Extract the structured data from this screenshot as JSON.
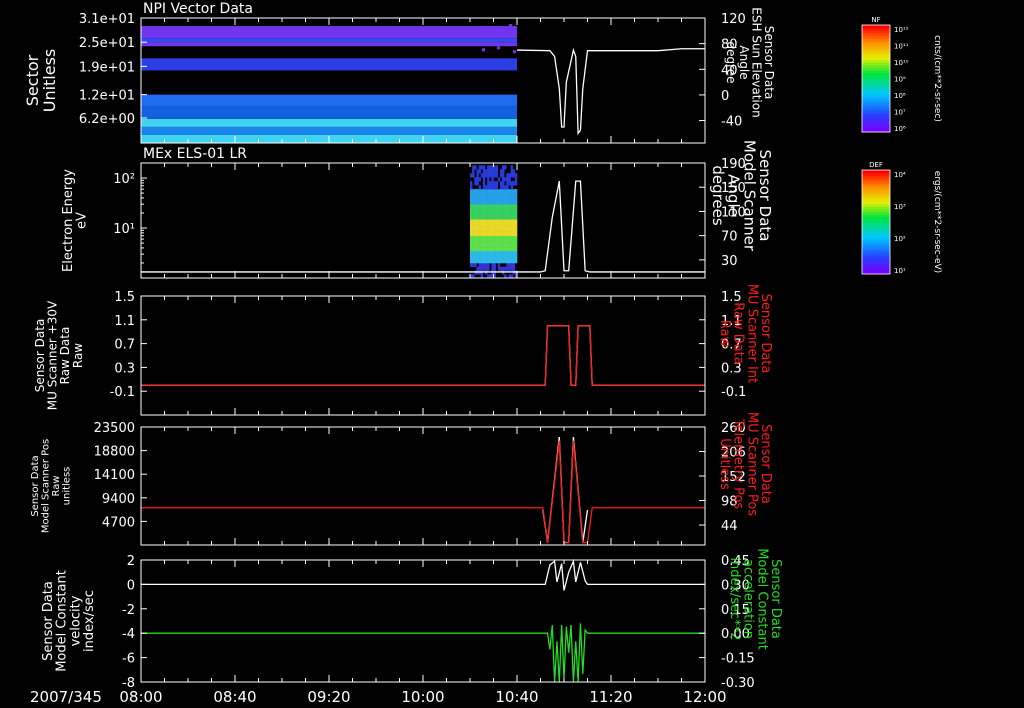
{
  "date_label": "2007/345",
  "time_ticks": [
    "08:00",
    "08:40",
    "09:20",
    "10:00",
    "10:40",
    "11:20",
    "12:00"
  ],
  "colors": {
    "white": "#ffffff",
    "red": "#ff1a1a",
    "green": "#22dd22",
    "frame": "#ffffff"
  },
  "chart_data": [
    {
      "type": "heatmap",
      "title": "NPI Vector Data",
      "ylabel": [
        "Sector",
        "Unitless"
      ],
      "yticks": [
        "3.1e+01",
        "2.5e+01",
        "1.9e+01",
        "1.2e+01",
        "6.2e+00"
      ],
      "ytick_values": [
        31,
        25,
        19,
        12,
        6.2
      ],
      "ylim": [
        0,
        31
      ],
      "x_data_range": [
        "08:00",
        "10:40"
      ],
      "bands": [
        {
          "y0": 0,
          "y1": 2,
          "color": "#3fd3f0"
        },
        {
          "y0": 2,
          "y1": 4,
          "color": "#1a84ea"
        },
        {
          "y0": 4,
          "y1": 6,
          "color": "#3fd3f0"
        },
        {
          "y0": 6,
          "y1": 9,
          "color": "#1260e0"
        },
        {
          "y0": 9,
          "y1": 12,
          "color": "#1e6af0"
        },
        {
          "y0": 18,
          "y1": 21,
          "color": "#2d3ee4"
        },
        {
          "y0": 24,
          "y1": 25,
          "color": "#7433ee"
        },
        {
          "y0": 25,
          "y1": 26,
          "color": "#2f4cf0"
        },
        {
          "y0": 26,
          "y1": 29,
          "color": "#7433ee"
        }
      ],
      "right_axis": {
        "label": [
          "Sensor Data",
          "ESH Sun Elevation",
          "Angle",
          "degree"
        ],
        "yticks": [
          "120",
          "80",
          "40",
          "0",
          "-40"
        ],
        "ytick_values": [
          120,
          80,
          40,
          0,
          -40
        ],
        "ylim": [
          -75,
          120
        ],
        "line_color": "#ffffff",
        "series": {
          "x": [
            "10:40",
            "10:54",
            "10:56",
            "10:58",
            "10:59",
            "11:00",
            "11:01",
            "11:04",
            "11:05",
            "11:06",
            "11:07",
            "11:08",
            "11:10",
            "11:40",
            "11:50",
            "12:00"
          ],
          "y": [
            70,
            69,
            60,
            10,
            -50,
            -50,
            20,
            70,
            60,
            -60,
            -55,
            10,
            69,
            69,
            72,
            72
          ]
        }
      },
      "colorbar": {
        "label": "NF",
        "units": "cnts/(cm**2-sr-sec)",
        "ticks": [
          "10¹²",
          "10¹¹",
          "10¹⁰",
          "10⁹",
          "10⁸",
          "10⁷",
          "10⁶"
        ]
      }
    },
    {
      "type": "heatmap",
      "title": "MEx ELS-01 LR",
      "ylabel": [
        "Electron Energy",
        "eV"
      ],
      "yticks": [
        "10²",
        "10¹"
      ],
      "ytick_values": [
        100,
        10
      ],
      "ylim_log": [
        1,
        200
      ],
      "x_data_range": [
        "10:20",
        "10:40"
      ],
      "energy_profile": [
        {
          "e0": 1,
          "e1": 2,
          "color": "#3333d0"
        },
        {
          "e0": 2,
          "e1": 3.5,
          "color": "#2cb8e8"
        },
        {
          "e0": 3.5,
          "e1": 7,
          "color": "#5ee04a"
        },
        {
          "e0": 7,
          "e1": 15,
          "color": "#e8d82a"
        },
        {
          "e0": 15,
          "e1": 30,
          "color": "#38d060"
        },
        {
          "e0": 30,
          "e1": 60,
          "color": "#26a0e6"
        },
        {
          "e0": 60,
          "e1": 180,
          "color": "#2a3ad8"
        }
      ],
      "right_axis": {
        "label": [
          "Sensor Data",
          "Model Scanner",
          "Angle",
          "degrees"
        ],
        "yticks": [
          "190",
          "150",
          "110",
          "70",
          "30"
        ],
        "ytick_values": [
          190,
          150,
          110,
          70,
          30
        ],
        "ylim": [
          0,
          190
        ],
        "line_color": "#ffffff",
        "series": {
          "x": [
            "08:00",
            "10:40",
            "10:50",
            "10:52",
            "10:55",
            "10:58",
            "11:00",
            "11:02",
            "11:05",
            "11:07",
            "11:09",
            "11:11",
            "11:14",
            "12:00"
          ],
          "y": [
            10,
            10,
            10,
            12,
            100,
            160,
            12,
            12,
            160,
            160,
            12,
            10,
            10,
            10
          ]
        }
      },
      "colorbar": {
        "label": "DEF",
        "units": "ergs/(cm**2-sr-sec-eV)",
        "ticks": [
          "10⁴",
          "10³",
          "10²",
          "10¹"
        ]
      }
    },
    {
      "type": "line",
      "ylabel": [
        "Sensor Data",
        "MU Scanner +30V",
        "Raw Data",
        "Raw"
      ],
      "yticks": [
        "1.5",
        "1.1",
        "0.7",
        "0.3",
        "-0.1"
      ],
      "ytick_values": [
        1.5,
        1.1,
        0.7,
        0.3,
        -0.1
      ],
      "ylim": [
        -0.5,
        1.5
      ],
      "right_axis": {
        "label": [
          "Sensor Data",
          "MU Scanner Int",
          "Raw Data",
          "Raw"
        ],
        "yticks": [
          "1.5",
          "1.1",
          "0.7",
          "0.3",
          "-0.1"
        ],
        "ytick_values": [
          1.5,
          1.1,
          0.7,
          0.3,
          -0.1
        ],
        "ylim": [
          -0.5,
          1.5
        ],
        "line_color": "#ff1a1a",
        "series": {
          "x": [
            "08:00",
            "10:52",
            "10:53",
            "11:02",
            "11:03",
            "11:05",
            "11:06",
            "11:11",
            "11:12",
            "12:00"
          ],
          "y": [
            0,
            0,
            1,
            1,
            0,
            0,
            1,
            1,
            0,
            0
          ]
        }
      },
      "series": [
        {
          "color": "#ffffff",
          "x": [
            "08:00",
            "10:52",
            "10:53",
            "11:02",
            "11:03",
            "11:05",
            "11:06",
            "11:11",
            "11:12",
            "12:00"
          ],
          "y": [
            0,
            0,
            1,
            1,
            0,
            0,
            1,
            1,
            0,
            0
          ]
        }
      ]
    },
    {
      "type": "line",
      "ylabel": [
        "Sensor Data",
        "Model Scanner Pos",
        "Raw",
        "unitless"
      ],
      "yticks": [
        "23500",
        "18800",
        "14100",
        "9400",
        "4700"
      ],
      "ytick_values": [
        23500,
        18800,
        14100,
        9400,
        4700
      ],
      "ylim": [
        0,
        23500
      ],
      "right_axis": {
        "label": [
          "Sensor Data",
          "MU Scanner Pos",
          "Telemetry Pos",
          "Unitless"
        ],
        "yticks": [
          "260",
          "206",
          "152",
          "98",
          "44"
        ],
        "ytick_values": [
          260,
          206,
          152,
          98,
          44
        ],
        "ylim": [
          0,
          260
        ],
        "line_color": "#ff1a1a",
        "series": {
          "x": [
            "08:00",
            "10:51",
            "10:53",
            "10:58",
            "11:00",
            "11:02",
            "11:04",
            "11:08",
            "11:10",
            "11:12",
            "12:00"
          ],
          "y": [
            82,
            82,
            5,
            230,
            5,
            5,
            230,
            5,
            5,
            82,
            82
          ]
        }
      },
      "series": [
        {
          "color": "#ffffff",
          "x": [
            "10:51",
            "10:53",
            "10:58",
            "11:00",
            "11:02",
            "11:04",
            "11:08",
            "11:10"
          ],
          "y": [
            7000,
            500,
            21500,
            500,
            500,
            21500,
            500,
            7000
          ]
        }
      ]
    },
    {
      "type": "line",
      "ylabel": [
        "Sensor Data",
        "Model Constant",
        "velocity",
        "index/sec"
      ],
      "yticks": [
        "2",
        "0",
        "-2",
        "-4",
        "-6",
        "-8"
      ],
      "ytick_values": [
        2,
        0,
        -2,
        -4,
        -6,
        -8
      ],
      "ylim": [
        -8,
        2
      ],
      "right_axis": {
        "label": [
          "Sensor Data",
          "Model Constant",
          "acceleration",
          "index/sec**2"
        ],
        "yticks": [
          "0.45",
          "0.30",
          "0.15",
          "0.00",
          "-0.15",
          "-0.30"
        ],
        "ytick_values": [
          0.45,
          0.3,
          0.15,
          0.0,
          -0.15,
          -0.3
        ],
        "ylim": [
          -0.3,
          0.45
        ],
        "line_color": "#22dd22",
        "series": {
          "x": [
            "08:00",
            "10:53",
            "10:54",
            "10:55",
            "10:56",
            "10:57",
            "10:58",
            "10:59",
            "11:00",
            "11:01",
            "11:02",
            "11:03",
            "11:04",
            "11:05",
            "11:06",
            "11:07",
            "11:08",
            "11:09",
            "11:10",
            "12:00"
          ],
          "y": [
            0,
            0,
            -0.1,
            0.05,
            -0.3,
            -0.05,
            -0.3,
            0.05,
            -0.28,
            0.04,
            -0.12,
            0.05,
            -0.3,
            -0.05,
            -0.3,
            0.06,
            -0.25,
            0.02,
            0,
            0
          ]
        }
      },
      "series": [
        {
          "color": "#ffffff",
          "x": [
            "08:00",
            "10:52",
            "10:54",
            "10:56",
            "10:57",
            "10:59",
            "11:00",
            "11:02",
            "11:04",
            "11:05",
            "11:07",
            "11:09",
            "11:10",
            "12:00"
          ],
          "y": [
            0,
            0,
            1.6,
            1.9,
            0.2,
            1.7,
            -0.5,
            1.0,
            1.9,
            0.2,
            1.8,
            0.3,
            0,
            0
          ]
        }
      ]
    }
  ]
}
